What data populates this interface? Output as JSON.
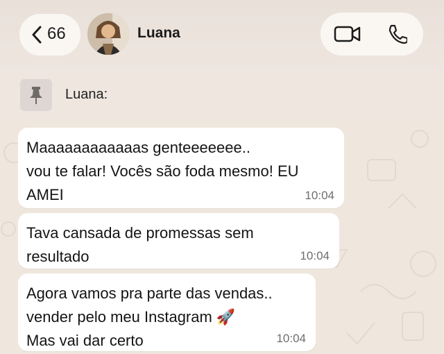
{
  "header": {
    "back_count": "66",
    "contact_name": "Luana"
  },
  "pinned": {
    "text": "Luana:"
  },
  "messages": [
    {
      "text": "Maaaaaaaaaaaas genteeeeeee..\nvou te falar! Vocês são foda mesmo! EU\nAMEI",
      "time": "10:04"
    },
    {
      "text": "Tava cansada de promessas sem\nresultado",
      "time": "10:04"
    },
    {
      "text": "Agora vamos pra parte das vendas..\nvender pelo meu Instagram 🚀\nMas vai dar certo",
      "time": "10:04"
    }
  ],
  "colors": {
    "chat_background": "#efe7dd",
    "bubble": "#ffffff",
    "header": "#ebe2dc"
  },
  "icons": [
    "chevron-left-icon",
    "video-call-icon",
    "phone-icon",
    "pin-icon"
  ]
}
